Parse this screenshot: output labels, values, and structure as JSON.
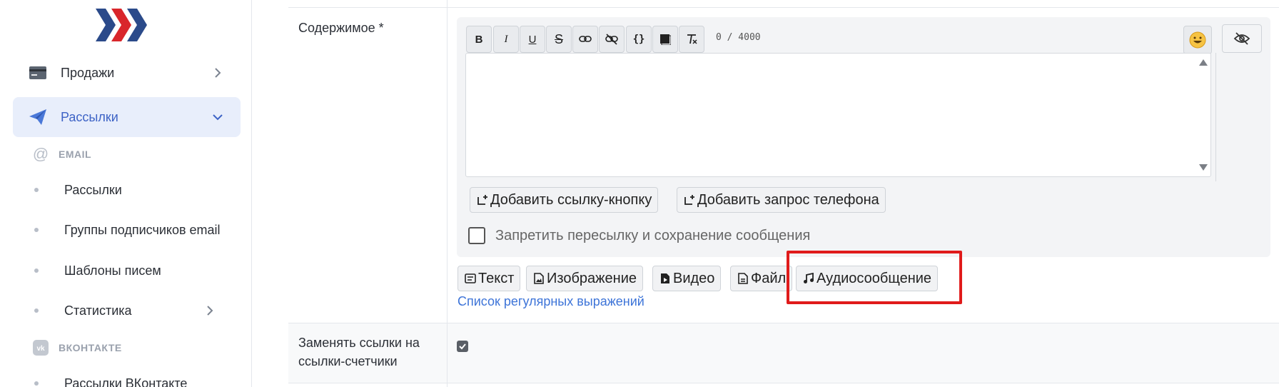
{
  "sidebar": {
    "items": [
      {
        "label": "Продажи",
        "icon": "credit-card-icon",
        "expanded": false
      },
      {
        "label": "Рассылки",
        "icon": "paper-plane-icon",
        "expanded": true
      }
    ],
    "sections": [
      {
        "label": "EMAIL",
        "icon": "at-sign-icon",
        "items": [
          {
            "label": "Рассылки"
          },
          {
            "label": "Группы подписчиков email"
          },
          {
            "label": "Шаблоны писем"
          },
          {
            "label": "Статистика",
            "has_children": true
          }
        ]
      },
      {
        "label": "ВКОНТАКТЕ",
        "icon": "vk-icon",
        "items": [
          {
            "label": "Рассылки ВКонтакте"
          }
        ]
      }
    ]
  },
  "form": {
    "content_label": "Содержимое *",
    "counter": "0 / 4000",
    "toolbar": [
      "bold",
      "italic",
      "underline",
      "strikethrough",
      "link",
      "unlink",
      "code",
      "spoiler",
      "clear-format"
    ],
    "add_link_button": "Добавить ссылку-кнопку",
    "add_phone_button": "Добавить запрос телефона",
    "forbid_forward_label": "Запретить пересылку и сохранение сообщения",
    "forbid_forward_checked": false,
    "content_types": [
      {
        "label": "Текст",
        "icon": "text-icon"
      },
      {
        "label": "Изображение",
        "icon": "image-file-icon"
      },
      {
        "label": "Видео",
        "icon": "video-file-icon"
      },
      {
        "label": "Файл",
        "icon": "file-icon"
      },
      {
        "label": "Аудиосообщение",
        "icon": "music-note-icon"
      }
    ],
    "regex_link": "Список регулярных выражений",
    "replace_links_label": "Заменять ссылки на ссылки-счетчики",
    "replace_links_checked": true
  },
  "colors": {
    "accent": "#3d63c6",
    "highlight": "#e01b1b",
    "link": "#3d74d8"
  }
}
